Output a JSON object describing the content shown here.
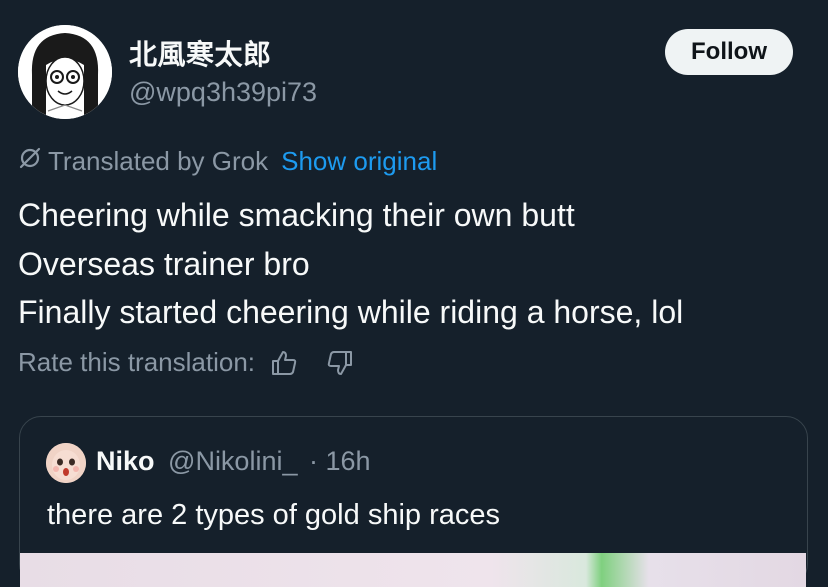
{
  "author": {
    "display_name": "北風寒太郎",
    "handle": "@wpq3h39pi73"
  },
  "follow_button": {
    "label": "Follow"
  },
  "translation": {
    "translated_by": "Translated by Grok",
    "show_original": "Show original"
  },
  "tweet": {
    "lines": [
      "Cheering while smacking their own butt",
      "Overseas trainer bro",
      "Finally started cheering while riding a horse, lol"
    ]
  },
  "rate": {
    "label": "Rate this translation:",
    "icons": [
      "thumbs-up-icon",
      "thumbs-down-icon"
    ]
  },
  "quoted_tweet": {
    "name": "Niko",
    "handle": "@Nikolini_",
    "time": "· 16h",
    "text": "there are 2 types of gold ship races"
  },
  "colors": {
    "background": "#15202b",
    "text_primary": "#f7f9f9",
    "text_secondary": "#8b98a5",
    "link": "#1d9bf0",
    "border": "#38444d",
    "button_bg": "#eff3f4"
  }
}
